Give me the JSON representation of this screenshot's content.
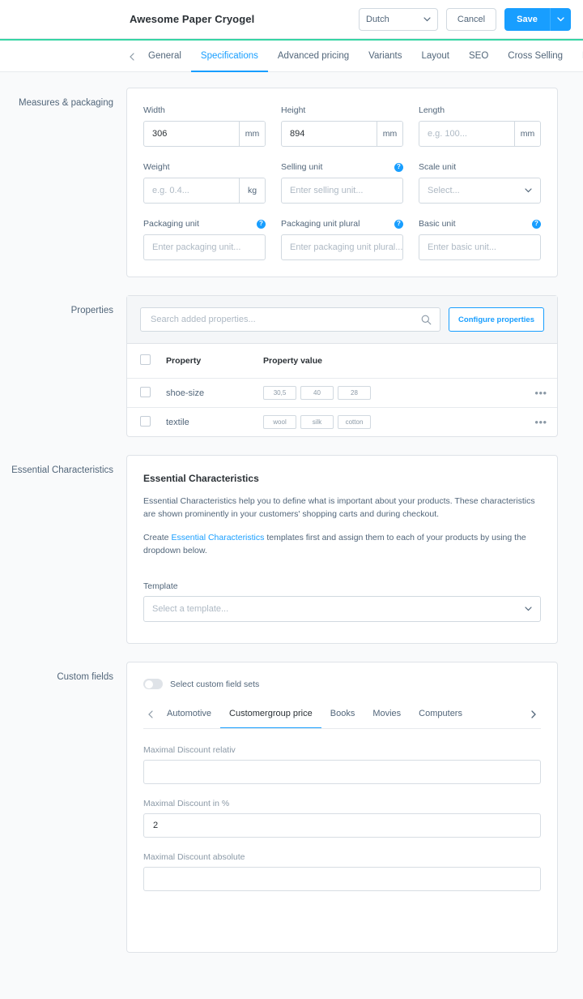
{
  "header": {
    "title": "Awesome Paper Cryogel",
    "language_value": "Dutch",
    "cancel_label": "Cancel",
    "save_label": "Save",
    "accent_color": "#189eff",
    "progress_color": "#37d5a5"
  },
  "tabs": {
    "prev_icon": "chevron-left-icon",
    "next_icon": "chevron-right-icon",
    "items": [
      {
        "label": "General",
        "active": false
      },
      {
        "label": "Specifications",
        "active": true
      },
      {
        "label": "Advanced pricing",
        "active": false
      },
      {
        "label": "Variants",
        "active": false
      },
      {
        "label": "Layout",
        "active": false
      },
      {
        "label": "SEO",
        "active": false
      },
      {
        "label": "Cross Selling",
        "active": false
      },
      {
        "label": "Rev",
        "active": false
      }
    ]
  },
  "measures": {
    "section_label": "Measures & packaging",
    "fields": {
      "width": {
        "label": "Width",
        "value": "306",
        "unit": "mm",
        "is_placeholder": false
      },
      "height": {
        "label": "Height",
        "value": "894",
        "unit": "mm",
        "is_placeholder": false
      },
      "length": {
        "label": "Length",
        "value": "e.g. 100...",
        "unit": "mm",
        "is_placeholder": true
      },
      "weight": {
        "label": "Weight",
        "value": "e.g. 0.4...",
        "unit": "kg",
        "is_placeholder": true
      },
      "selling_unit": {
        "label": "Selling unit",
        "value": "Enter selling unit...",
        "is_placeholder": true,
        "help": true
      },
      "scale_unit": {
        "label": "Scale unit",
        "value": "Select...",
        "is_placeholder": true,
        "help": false
      },
      "packaging_unit": {
        "label": "Packaging unit",
        "value": "Enter packaging unit...",
        "is_placeholder": true,
        "help": true
      },
      "packaging_unit_plural": {
        "label": "Packaging unit plural",
        "value": "Enter packaging unit plural...",
        "is_placeholder": true,
        "help": true
      },
      "basic_unit": {
        "label": "Basic unit",
        "value": "Enter basic unit...",
        "is_placeholder": true,
        "help": true
      }
    }
  },
  "properties": {
    "section_label": "Properties",
    "search_placeholder": "Search added properties...",
    "search_value": "",
    "configure_label": "Configure properties",
    "columns": {
      "property": "Property",
      "property_value": "Property value"
    },
    "rows": [
      {
        "name": "shoe-size",
        "values": [
          "30,5",
          "40",
          "28"
        ]
      },
      {
        "name": "textile",
        "values": [
          "wool",
          "silk",
          "cotton"
        ]
      }
    ]
  },
  "essential": {
    "section_label": "Essential Characteristics",
    "card_title": "Essential Characteristics",
    "paragraph_1": "Essential Characteristics help you to define what is important about your products. These characteristics are shown prominently in your customers' shopping carts and during checkout.",
    "paragraph_2_before": "Create ",
    "paragraph_2_link": "Essential Characteristics",
    "paragraph_2_after": " templates first and assign them to each of your products by using the dropdown below.",
    "template_label": "Template",
    "template_placeholder": "Select a template..."
  },
  "custom_fields": {
    "section_label": "Custom fields",
    "toggle_label": "Select custom field sets",
    "toggle_on": false,
    "tabs": [
      {
        "label": "Automotive",
        "active": false
      },
      {
        "label": "Customergroup price",
        "active": true
      },
      {
        "label": "Books",
        "active": false
      },
      {
        "label": "Movies",
        "active": false
      },
      {
        "label": "Computers",
        "active": false
      }
    ],
    "fields": [
      {
        "label": "Maximal Discount relativ",
        "value": ""
      },
      {
        "label": "Maximal Discount in %",
        "value": "2"
      },
      {
        "label": "Maximal Discount absolute",
        "value": ""
      }
    ]
  }
}
